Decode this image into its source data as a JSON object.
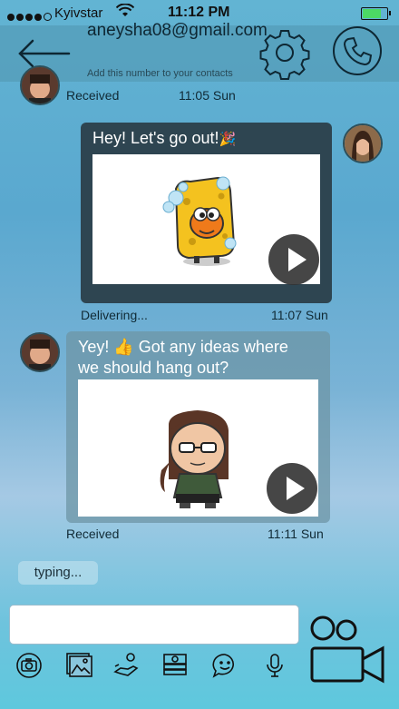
{
  "status_bar": {
    "carrier": "Kyivstar",
    "time": "11:12 PM",
    "battery_level": 0.85,
    "battery_color": "#4cd964"
  },
  "header": {
    "contact": "aneysha08@gmail.com",
    "hint": "Add this number to your contacts",
    "icons": [
      "back-arrow-icon",
      "gear-icon",
      "phone-icon"
    ]
  },
  "messages": [
    {
      "direction": "in",
      "status": "Received",
      "time": "11:05 Sun"
    },
    {
      "direction": "out",
      "text": "Hey! Let's go out!",
      "emoji": "🎉",
      "media": "sponge-sticker",
      "status": "Delivering...",
      "time": "11:07 Sun"
    },
    {
      "direction": "in",
      "text_line1": "Yey! 👍 Got any ideas where",
      "text_line2": "we should hang out?",
      "media": "girl-sticker",
      "status": "Received",
      "time": "11:11 Sun"
    }
  ],
  "typing": "typing...",
  "composer": {
    "value": "",
    "placeholder": ""
  },
  "toolbar_icons": [
    "camera-icon",
    "gallery-icon",
    "money-hand-icon",
    "cash-icon",
    "smiley-chat-icon",
    "microphone-icon"
  ],
  "video_call_icon": "video-camera-icon"
}
